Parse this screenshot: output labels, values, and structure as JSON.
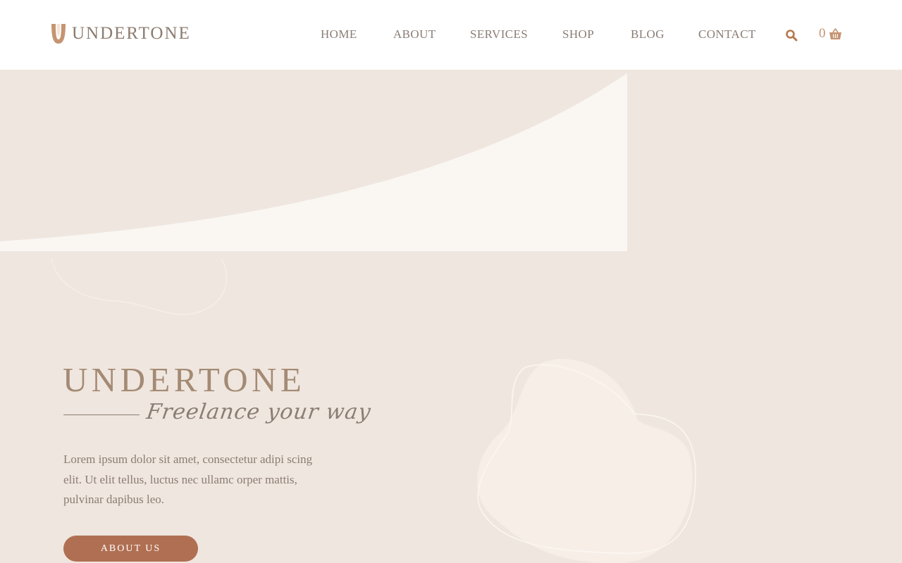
{
  "brand": {
    "logo_label": "UNDERTONE"
  },
  "nav": {
    "items": [
      {
        "label": "HOME"
      },
      {
        "label": "ABOUT"
      },
      {
        "label": "SERVICES"
      },
      {
        "label": "SHOP"
      },
      {
        "label": "BLOG"
      },
      {
        "label": "CONTACT"
      }
    ],
    "search_icon": "search-icon",
    "cart": {
      "count": "0",
      "icon": "basket-icon"
    }
  },
  "hero": {
    "title": "UNDERTONE",
    "tagline": "Freelance your way",
    "body": "Lorem ipsum dolor sit amet, consectetur adipi scing elit. Ut elit tellus, luctus nec ullamc orper mattis, pulvinar dapibus leo.",
    "button_label": "ABOUT US"
  },
  "colors": {
    "page_background": "#EFE6DF",
    "header_background": "#FFFFFF",
    "cream_panel": "#FAF7F3",
    "accent": "#B06F52",
    "accent_light": "#C59472",
    "title": "#A48A74",
    "text": "#8A7D74"
  }
}
